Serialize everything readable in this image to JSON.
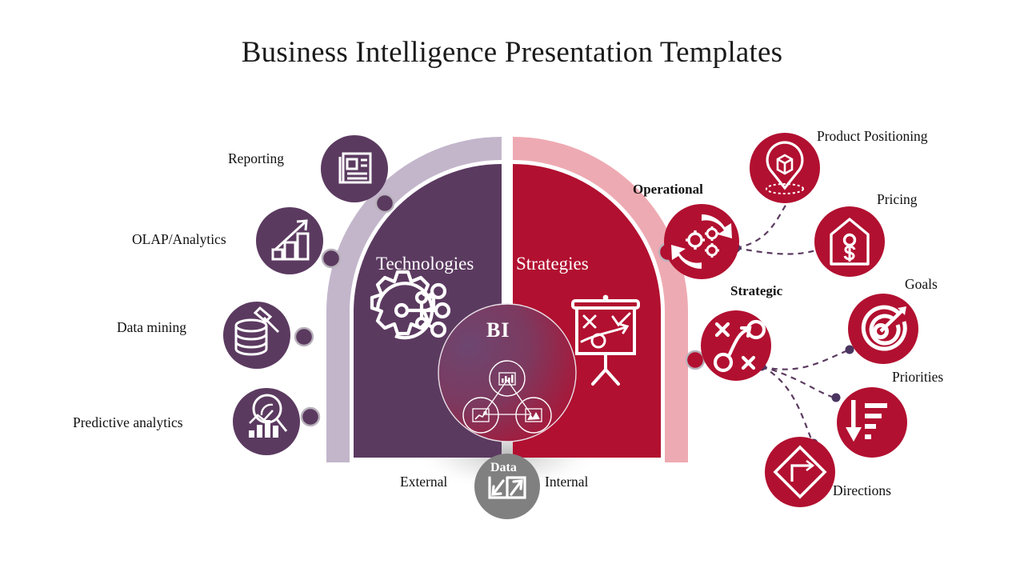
{
  "title": "Business Intelligence Presentation Templates",
  "colors": {
    "purple_dark": "#5b3a60",
    "purple_light": "#c3b6cb",
    "red_dark": "#b21030",
    "red_light": "#eeaab2",
    "gray": "#808080",
    "connector": "#5b3a60",
    "text": "#111111"
  },
  "hub": {
    "label": "BI",
    "icons": [
      {
        "name": "bar-chart-icon"
      },
      {
        "name": "line-chart-icon"
      },
      {
        "name": "area-chart-icon"
      }
    ]
  },
  "arcs": {
    "left": {
      "label": "Technologies",
      "icon": "gear-network-icon"
    },
    "right": {
      "label": "Strategies",
      "icon": "strategy-board-icon"
    }
  },
  "data_node": {
    "label": "Data",
    "icon": "import-export-icon",
    "left_label": "External",
    "right_label": "Internal"
  },
  "left_items": [
    {
      "label": "Reporting",
      "icon": "newspaper-report-icon"
    },
    {
      "label": "OLAP/Analytics",
      "icon": "growth-bar-chart-icon"
    },
    {
      "label": "Data mining",
      "icon": "database-hammer-icon"
    },
    {
      "label": "Predictive analytics",
      "icon": "magnifier-chart-icon"
    }
  ],
  "right_groups": [
    {
      "label": "Operational",
      "icon": "gears-cycle-icon"
    },
    {
      "label": "Strategic",
      "icon": "tactics-play-icon"
    }
  ],
  "right_items": [
    {
      "label": "Product Positioning",
      "icon": "pin-cube-icon"
    },
    {
      "label": "Pricing",
      "icon": "price-tag-dollar-icon"
    },
    {
      "label": "Goals",
      "icon": "target-arrow-icon"
    },
    {
      "label": "Priorities",
      "icon": "sort-descending-icon"
    },
    {
      "label": "Directions",
      "icon": "diamond-arrow-icon"
    }
  ]
}
